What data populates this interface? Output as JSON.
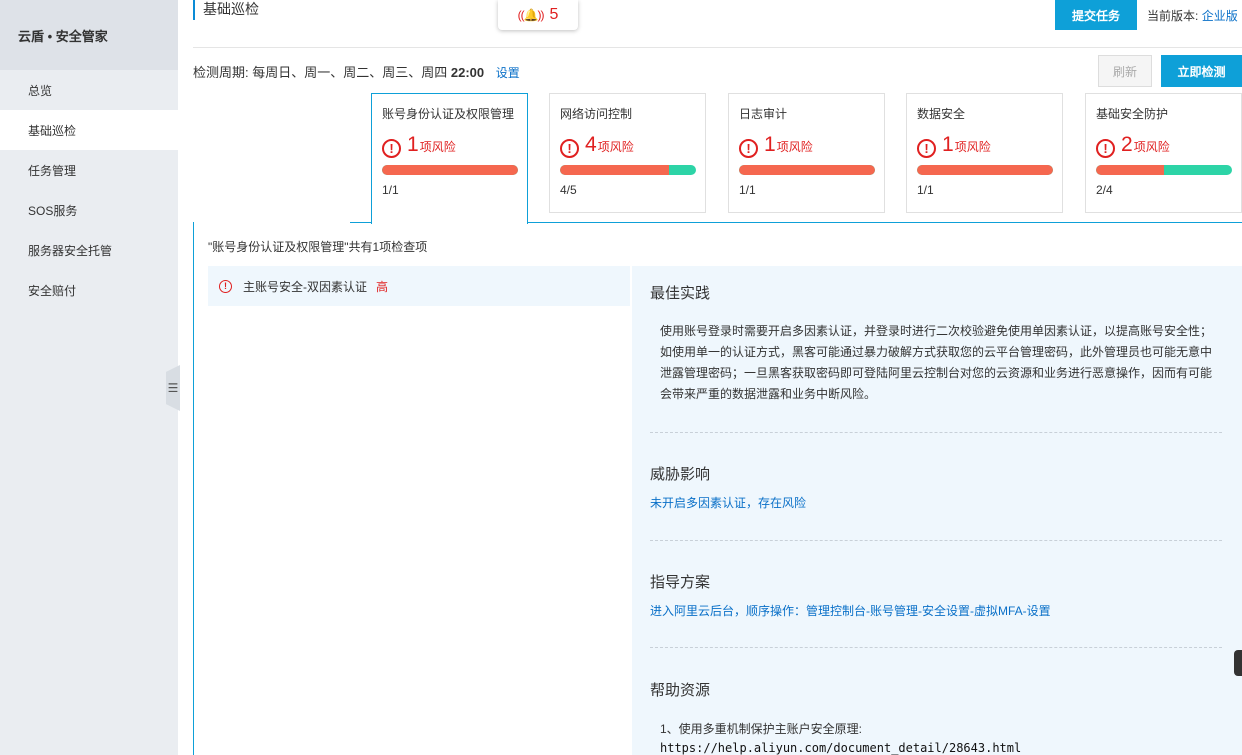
{
  "sidebar": {
    "title": "云盾 • 安全管家",
    "items": [
      {
        "label": "总览",
        "active": false
      },
      {
        "label": "基础巡检",
        "active": true
      },
      {
        "label": "任务管理",
        "active": false
      },
      {
        "label": "SOS服务",
        "active": false
      },
      {
        "label": "服务器安全托管",
        "active": false
      },
      {
        "label": "安全赔付",
        "active": false
      }
    ]
  },
  "header": {
    "page_title": "基础巡检",
    "bell_icon": "bell-icon",
    "alert_count": "5",
    "submit_label": "提交任务",
    "version_label": "当前版本:",
    "version_value": "企业版"
  },
  "schedule": {
    "label": "检测周期:",
    "days": "每周日、周一、周二、周三、周四",
    "time": "22:00",
    "setup": "设置"
  },
  "actions": {
    "refresh": "刷新",
    "check_now": "立即检测"
  },
  "cards": [
    {
      "title": "账号身份认证及权限管理",
      "risk_count": "1",
      "risk_unit": "项风险",
      "ratio": "1/1",
      "risk_fraction": 1.0,
      "active": true
    },
    {
      "title": "网络访问控制",
      "risk_count": "4",
      "risk_unit": "项风险",
      "ratio": "4/5",
      "risk_fraction": 0.8,
      "active": false
    },
    {
      "title": "日志审计",
      "risk_count": "1",
      "risk_unit": "项风险",
      "ratio": "1/1",
      "risk_fraction": 1.0,
      "active": false
    },
    {
      "title": "数据安全",
      "risk_count": "1",
      "risk_unit": "项风险",
      "ratio": "1/1",
      "risk_fraction": 1.0,
      "active": false
    },
    {
      "title": "基础安全防护",
      "risk_count": "2",
      "risk_unit": "项风险",
      "ratio": "2/4",
      "risk_fraction": 0.5,
      "active": false
    }
  ],
  "detail": {
    "summary": "\"账号身份认证及权限管理\"共有1项检查项",
    "items": [
      {
        "label": "主账号安全-双因素认证",
        "level": "高"
      }
    ],
    "best_practice_title": "最佳实践",
    "best_practice_text": "使用账号登录时需要开启多因素认证，并登录时进行二次校验避免使用单因素认证，以提高账号安全性；如使用单一的认证方式，黑客可能通过暴力破解方式获取您的云平台管理密码，此外管理员也可能无意中泄露管理密码；一旦黑客获取密码即可登陆阿里云控制台对您的云资源和业务进行恶意操作，因而有可能会带来严重的数据泄露和业务中断风险。",
    "threat_title": "威胁影响",
    "threat_text": "未开启多因素认证，存在风险",
    "guide_title": "指导方案",
    "guide_text": "进入阿里云后台，顺序操作：管理控制台-账号管理-安全设置-虚拟MFA-设置",
    "help_title": "帮助资源",
    "help_item": "1、使用多重机制保护主账户安全原理:",
    "help_url": "https://help.aliyun.com/document_detail/28643.html"
  },
  "colors": {
    "accent": "#0ea0d8",
    "risk": "#e02020",
    "bar_risk": "#f5674f",
    "bar_ok": "#2dd4a7"
  }
}
